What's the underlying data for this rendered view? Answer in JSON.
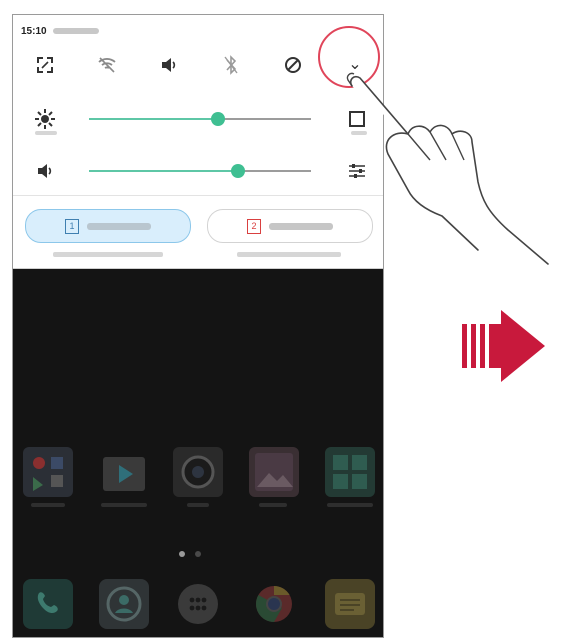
{
  "status_bar": {
    "time": "15:10"
  },
  "quick_settings": {
    "icons": [
      "screen-capture-icon",
      "wifi-off-icon",
      "sound-icon",
      "bluetooth-off-icon",
      "do-not-disturb-icon",
      "expand-chevron-icon"
    ],
    "expand_label": "⌄"
  },
  "brightness_slider": {
    "value": 0.58
  },
  "volume_slider": {
    "value": 0.67
  },
  "sim_cards": [
    {
      "badge": "1",
      "active": true
    },
    {
      "badge": "2",
      "active": false
    }
  ],
  "colors": {
    "slider_accent": "#3fbf92",
    "highlight_circle": "#e0455a",
    "arrow": "#c8193c",
    "home_dark": "#141414"
  }
}
